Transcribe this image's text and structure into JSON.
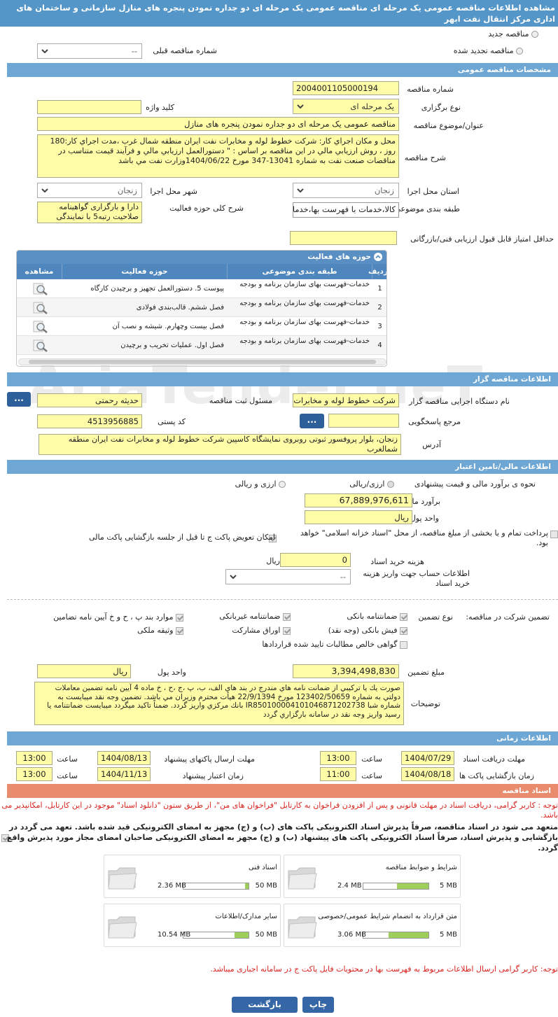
{
  "page": {
    "title": "مشاهده اطلاعات مناقصه عمومی یک مرحله ای مناقصه عمومی یک مرحله ای دو جداره نمودن پنجره های منازل سازمانی و ساختمان های اداری مرکز انتقال نفت ابهر"
  },
  "type_radio": {
    "new": "مناقصه جدید",
    "renewed": "مناقصه تجدید شده",
    "prev_label": "شماره مناقصه قبلی",
    "prev_value": "--"
  },
  "sections": {
    "general": "مشخصات مناقصه عمومی",
    "organizer": "اطلاعات مناقصه گزار",
    "financial": "اطلاعات مالی/تامین اعتبار",
    "timing": "اطلاعات زمانی",
    "docs": "اسناد مناقصه"
  },
  "general": {
    "number_label": "شماره مناقصه",
    "number": "2004001105000194",
    "hold_label": "نوع برگزاری",
    "hold": "یک مرحله ای",
    "keyword_label": "کلید واژه",
    "keyword": "",
    "subject_label": "عنوان/موضوع مناقصه",
    "subject": "مناقصه عمومی یک مرحله ای دو جداره نمودن پنجره های منازل",
    "desc_label": "شرح مناقصه",
    "desc": "محل و مكان اجراي كار: شركت خطوط لوله و مخابرات نفت ايران منطقه شمال غرب ،مدت اجراي كار:180 روز ، روش ارزيابي مالي در اين مناقصه بر اساس : \" دستورالعمل ارزيابي مالي و فرآيند قيمت متناسب در مناقصات صنعت نفت به شماره 13041-347 مورخ 1404/06/22وزارت نفت مي باشد",
    "province_label": "استان محل اجرا",
    "province": "زنجان",
    "city_label": "شهر محل اجرا",
    "city": "زنجان",
    "category_label": "طبقه بندی موضوعی",
    "category": "کالا،خدمات با فهرست بها،خدمات با فهرست بها،",
    "scope_label": "شرح کلی حوزه فعالیت",
    "scope": "دارا و بارگزاری گواهینامه صلاحیت رتبه5 با نمایندگی",
    "minscore_label": "حداقل امتیاز قابل قبول ارزیابی فنی/بازرگانی",
    "minscore": ""
  },
  "activity": {
    "title": "حوزه های فعالیت",
    "cols": [
      "ردیف",
      "طبقه بندی موضوعی",
      "حوزه فعالیت",
      "مشاهده"
    ],
    "rows": [
      {
        "n": "1",
        "cat": "خدمات-فهرست بهای سازمان برنامه و بودجه",
        "scope": "پیوست 5. دستورالعمل تجهیز و برچیدن کارگاه"
      },
      {
        "n": "2",
        "cat": "خدمات-فهرست بهای سازمان برنامه و بودجه",
        "scope": "فصل ششم. قالب‌بندی فولادی"
      },
      {
        "n": "3",
        "cat": "خدمات-فهرست بهای سازمان برنامه و بودجه",
        "scope": "فصل بیست وچهارم. شیشه و نصب آن"
      },
      {
        "n": "4",
        "cat": "خدمات-فهرست بهای سازمان برنامه و بودجه",
        "scope": "فصل اول. عملیات تخریب و برچیدن"
      }
    ]
  },
  "organizer": {
    "org_label": "نام دستگاه اجرایی مناقصه گزار",
    "org": "شرکت خطوط لوله و مخابرات",
    "resp_label": "مسئول ثبت مناقصه",
    "resp": "حدیثه رحمتی",
    "ref_label": "مرجع پاسخگویی",
    "ref": "",
    "postal_label": "کد پستی",
    "postal": "4513956885",
    "addr_label": "آدرس",
    "addr": "زنجان، بلوار پروفسور ثبوتی روبروی نمایشگاه کاسپین شرکت خطوط لوله و مخابرات نفت ایران منطقه شمالغرب",
    "btn": "..."
  },
  "financial": {
    "method_label": "نحوه ی برآورد مالی و قیمت پیشنهادی",
    "opt1": "ارزی/ریالی",
    "opt2": "ارزی و ریالی",
    "est_label": "برآورد مالی",
    "est": "67,889,976,611",
    "cur_label": "واحد پول",
    "cur": "ریال",
    "treasury": "پرداخت تمام و یا بخشی از مبلغ مناقصه، از محل \"اسناد خزانه اسلامی\" خواهد بود.",
    "replace": "امکان تعویض پاکت ج تا قبل از جلسه بازگشایی پاکت مالی",
    "docfee_label": "هزینه خرید اسناد",
    "docfee": "0",
    "docfee_unit": "ریال",
    "account_label": "اطلاعات حساب جهت واریز هزینه خرید اسناد",
    "account": "--"
  },
  "guarantee": {
    "label": "تضمین شرکت در مناقصه:",
    "type_label": "نوع تضمین",
    "items": [
      "ضمانتنامه بانکی",
      "ضمانتنامه غیربانکی",
      "موارد بند پ ، ح و خ آیین نامه تضامین",
      "فیش بانکی (وجه نقد)",
      "اوراق مشارکت",
      "وثیقه ملکی",
      "گواهی خالص مطالبات تایید شده قراردادها"
    ],
    "amount_label": "مبلغ تضمین",
    "amount": "3,394,498,830",
    "cur_label": "واحد پول",
    "cur": "ریال",
    "notes_label": "توضیحات",
    "notes": "صورت يك يا تركيبي از ضمانت نامه هاي مندرج در بند هاي الف، ب، پ ،ج ،ح ، خ ماده 4 آيين نامه تضمين معاملات دولتي به شماره 123402/50659 مورخ 22/9/1394 هيأت محترم وزيران مي باشد. تضمين وجه نقد ميبايست به شماره شبا IR850100004101046871202738 بانك مركزي واريز گردد. ضمناً تاكيد ميگردد ميبايست ضمانتنامه يا رسيد واريز وجه نقد در سامانه بارگزاري گردد"
  },
  "timing": {
    "recv_label": "مهلت دریافت اسناد",
    "recv_date": "1404/07/29",
    "recv_time": "13:00",
    "send_label": "مهلت ارسال پاکتهای پیشنهاد",
    "send_date": "1404/08/13",
    "send_time": "13:00",
    "open_label": "زمان بازگشایی پاکت ها",
    "open_date": "1404/08/18",
    "open_time": "11:00",
    "valid_label": "زمان اعتبار پیشنهاد",
    "valid_date": "1404/11/13",
    "valid_time": "13:00",
    "time_label": "ساعت"
  },
  "docs": {
    "note1": "توجه : کاربر گرامی، دریافت اسناد در مهلت قانونی و پس از افزودن فراخوان به کارتابل \"فراخوان های من\"، از طریق ستون \"دانلود اسناد\" موجود در این کارتابل، امکانپذیر می باشد.",
    "note2": "متعهد می شود در اسناد مناقصه، صرفاً پذیرش اسناد الکترونیکی پاکت های (ب) و (ج) مجهز به امضای الکترونیکی قید شده باشد. تعهد می گردد در بازگشایی و پذیرش اسناد، صرفاً اسناد الکترونیکی پاکت های پیشنهاد (ب) و (ج) مجهز به امضای الکترونیکی صاحبان امضای مجاز مورد پذیرش واقع گردد.",
    "files": [
      {
        "name": "شرایط و ضوابط مناقصه",
        "size": "2.4 MB",
        "max": "5 MB",
        "fill": 0.48
      },
      {
        "name": "اسناد فنی",
        "size": "2.36 MB",
        "max": "50 MB",
        "fill": 0.05
      },
      {
        "name": "متن قرارداد به انضمام شرایط عمومی/خصوصی",
        "size": "3.06 MB",
        "max": "5 MB",
        "fill": 0.61
      },
      {
        "name": "سایر مدارک/اطلاعات",
        "size": "10.54 MB",
        "max": "50 MB",
        "fill": 0.21
      }
    ],
    "note3": "توجه: کاربر گرامی ارسال اطلاعات مربوط به فهرست بها در محتویات فایل پاکت ج در سامانه اجباری میباشد."
  },
  "buttons": {
    "back": "بازگشت",
    "print": "چاپ"
  },
  "watermark": "AriaTender.neT"
}
